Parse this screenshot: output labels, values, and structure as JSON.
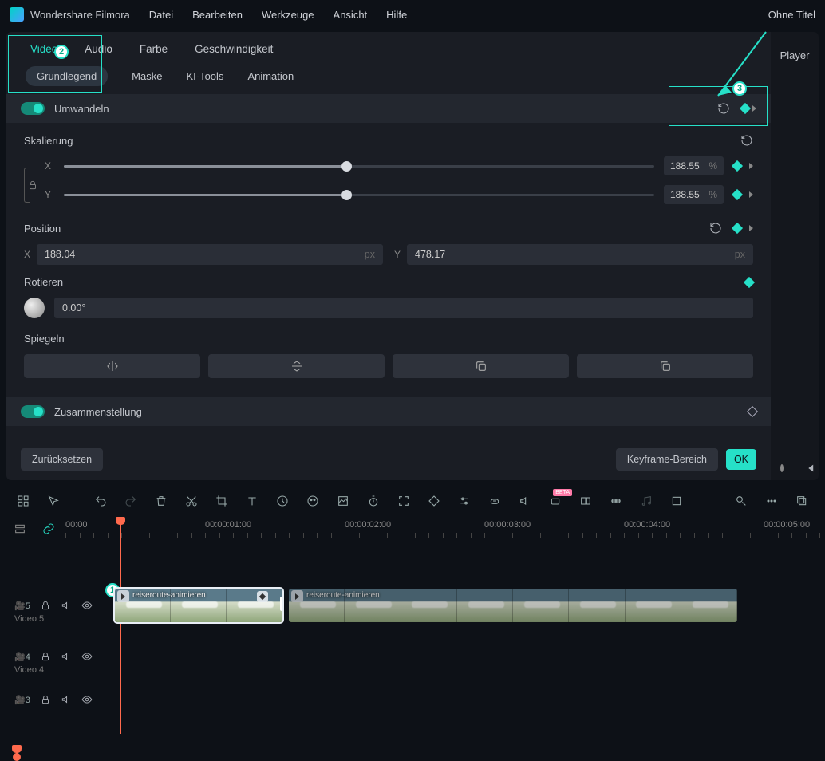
{
  "app": {
    "name": "Wondershare Filmora",
    "docTitle": "Ohne Titel"
  },
  "menu": [
    "Datei",
    "Bearbeiten",
    "Werkzeuge",
    "Ansicht",
    "Hilfe"
  ],
  "player": {
    "title": "Player"
  },
  "tabsPrimary": {
    "items": [
      "Video",
      "Audio",
      "Farbe",
      "Geschwindigkeit"
    ],
    "active": "Video"
  },
  "tabsSecondary": {
    "items": [
      "Grundlegend",
      "Maske",
      "KI-Tools",
      "Animation"
    ],
    "active": "Grundlegend"
  },
  "annotations": {
    "step1": "1",
    "step2": "2",
    "step3": "3"
  },
  "sections": {
    "transform": {
      "title": "Umwandeln"
    },
    "scaling": {
      "title": "Skalierung",
      "x": {
        "label": "X",
        "value": "188.55",
        "unit": "%"
      },
      "y": {
        "label": "Y",
        "value": "188.55",
        "unit": "%"
      }
    },
    "position": {
      "title": "Position",
      "x": {
        "label": "X",
        "value": "188.04",
        "unit": "px"
      },
      "y": {
        "label": "Y",
        "value": "478.17",
        "unit": "px"
      }
    },
    "rotate": {
      "title": "Rotieren",
      "value": "0.00°"
    },
    "mirror": {
      "title": "Spiegeln"
    },
    "composite": {
      "title": "Zusammenstellung"
    }
  },
  "buttons": {
    "reset": "Zurücksetzen",
    "keyframeRange": "Keyframe-Bereich",
    "ok": "OK"
  },
  "timeline": {
    "ruler": [
      "00:00",
      "00:00:01:00",
      "00:00:02:00",
      "00:00:03:00",
      "00:00:04:00",
      "00:00:05:00"
    ],
    "tracks": [
      {
        "id": 5,
        "label": "Video 5",
        "iconNum": "5"
      },
      {
        "id": 4,
        "label": "Video 4",
        "iconNum": "4"
      },
      {
        "id": 3,
        "label": "",
        "iconNum": "3"
      }
    ],
    "clipLabel": "reiseroute-animieren"
  },
  "toolbar": {
    "beta": "BETA"
  }
}
